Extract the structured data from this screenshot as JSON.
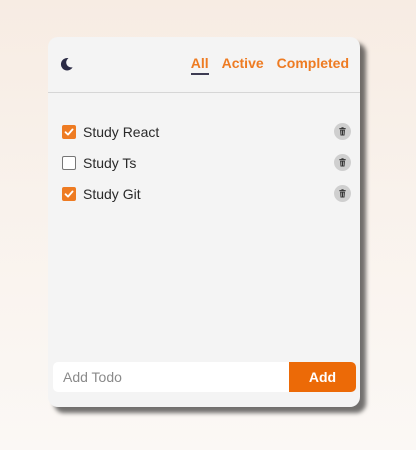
{
  "theme": {
    "accent": "#ee7b22",
    "button_color": "#ec6a07",
    "underline_color": "#3d3b52",
    "card_background": "#f4f4f4",
    "toggle_icon": "moon-icon"
  },
  "filters": {
    "all_label": "All",
    "active_label": "Active",
    "completed_label": "Completed",
    "selected": "All"
  },
  "todos": [
    {
      "text": "Study React",
      "completed": true
    },
    {
      "text": "Study Ts",
      "completed": false
    },
    {
      "text": "Study Git",
      "completed": true
    }
  ],
  "add": {
    "placeholder": "Add Todo",
    "value": "",
    "button_label": "Add"
  },
  "icons": {
    "delete": "trash-icon",
    "check": "check-icon"
  }
}
